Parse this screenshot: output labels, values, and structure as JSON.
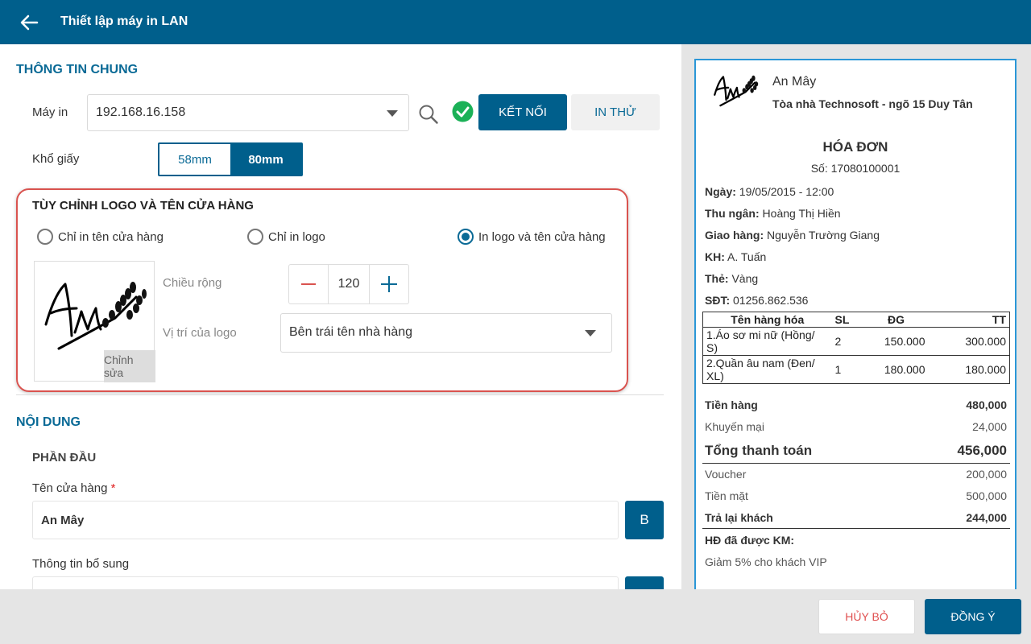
{
  "header": {
    "title": "Thiết lập máy in LAN",
    "back_icon": "arrow-left-icon"
  },
  "general": {
    "section_title": "THÔNG TIN CHUNG",
    "printer_label": "Máy in",
    "printer_value": "192.168.16.158",
    "connect_label": "KẾT NỐI",
    "test_print_label": "IN THỬ",
    "connected_color": "#1bb157",
    "paper_label": "Khổ giấy",
    "paper_options": [
      "58mm",
      "80mm"
    ],
    "paper_selected": "80mm"
  },
  "logo_section": {
    "title": "TÙY CHỈNH LOGO VÀ TÊN CỬA HÀNG",
    "radio_options": [
      "Chỉ in tên cửa hàng",
      "Chỉ in logo",
      "In logo và tên cửa hàng"
    ],
    "radio_selected": "In logo và tên cửa hàng",
    "edit_label": "Chỉnh sửa",
    "width_label": "Chiều rộng",
    "width_value": "120",
    "position_label": "Vị trí của logo",
    "position_value": "Bên trái tên nhà hàng",
    "highlight_color": "#d9534f"
  },
  "content": {
    "section_title": "NỘI DUNG",
    "subsection": "PHẦN ĐẦU",
    "store_name_label": "Tên cửa hàng",
    "required_mark": "*",
    "store_name_value": "An Mây",
    "bold_label": "B",
    "extra_info_label": "Thông tin bổ sung"
  },
  "receipt": {
    "store_name": "An Mây",
    "address": "Tòa nhà Technosoft - ngõ 15 Duy Tân",
    "title": "HÓA ĐƠN",
    "number": "Số: 17080100001",
    "fields": [
      {
        "label": "Ngày:",
        "value": "19/05/2015 - 12:00"
      },
      {
        "label": "Thu ngân:",
        "value": "Hoàng Thị Hiền"
      },
      {
        "label": "Giao hàng:",
        "value": "Nguyễn Trường Giang"
      },
      {
        "label": "KH:",
        "value": "A. Tuấn"
      },
      {
        "label": "Thẻ:",
        "value": "Vàng"
      },
      {
        "label": "SĐT:",
        "value": "01256.862.536"
      }
    ],
    "table_headers": [
      "Tên hàng hóa",
      "SL",
      "ĐG",
      "TT"
    ],
    "items": [
      {
        "name": "1.Áo sơ mi nữ (Hồng/ S)",
        "qty": "2",
        "price": "150.000",
        "total": "300.000"
      },
      {
        "name": "2.Quần âu nam (Đen/ XL)",
        "qty": "1",
        "price": "180.000",
        "total": "180.000"
      }
    ],
    "subtotal_label": "Tiền hàng",
    "subtotal_value": "480,000",
    "discount_label": "Khuyến mại",
    "discount_value": "24,000",
    "grand_label": "Tổng thanh toán",
    "grand_value": "456,000",
    "voucher_label": "Voucher",
    "voucher_value": "200,000",
    "cash_label": "Tiền mặt",
    "cash_value": "500,000",
    "change_label": "Trả lại khách",
    "change_value": "244,000",
    "promo_label": "HĐ đã được KM:",
    "promo_value": "Giảm 5% cho khách VIP",
    "border_color": "#2b97d7"
  },
  "footer": {
    "cancel_label": "HỦY BỎ",
    "ok_label": "ĐỒNG Ý"
  }
}
